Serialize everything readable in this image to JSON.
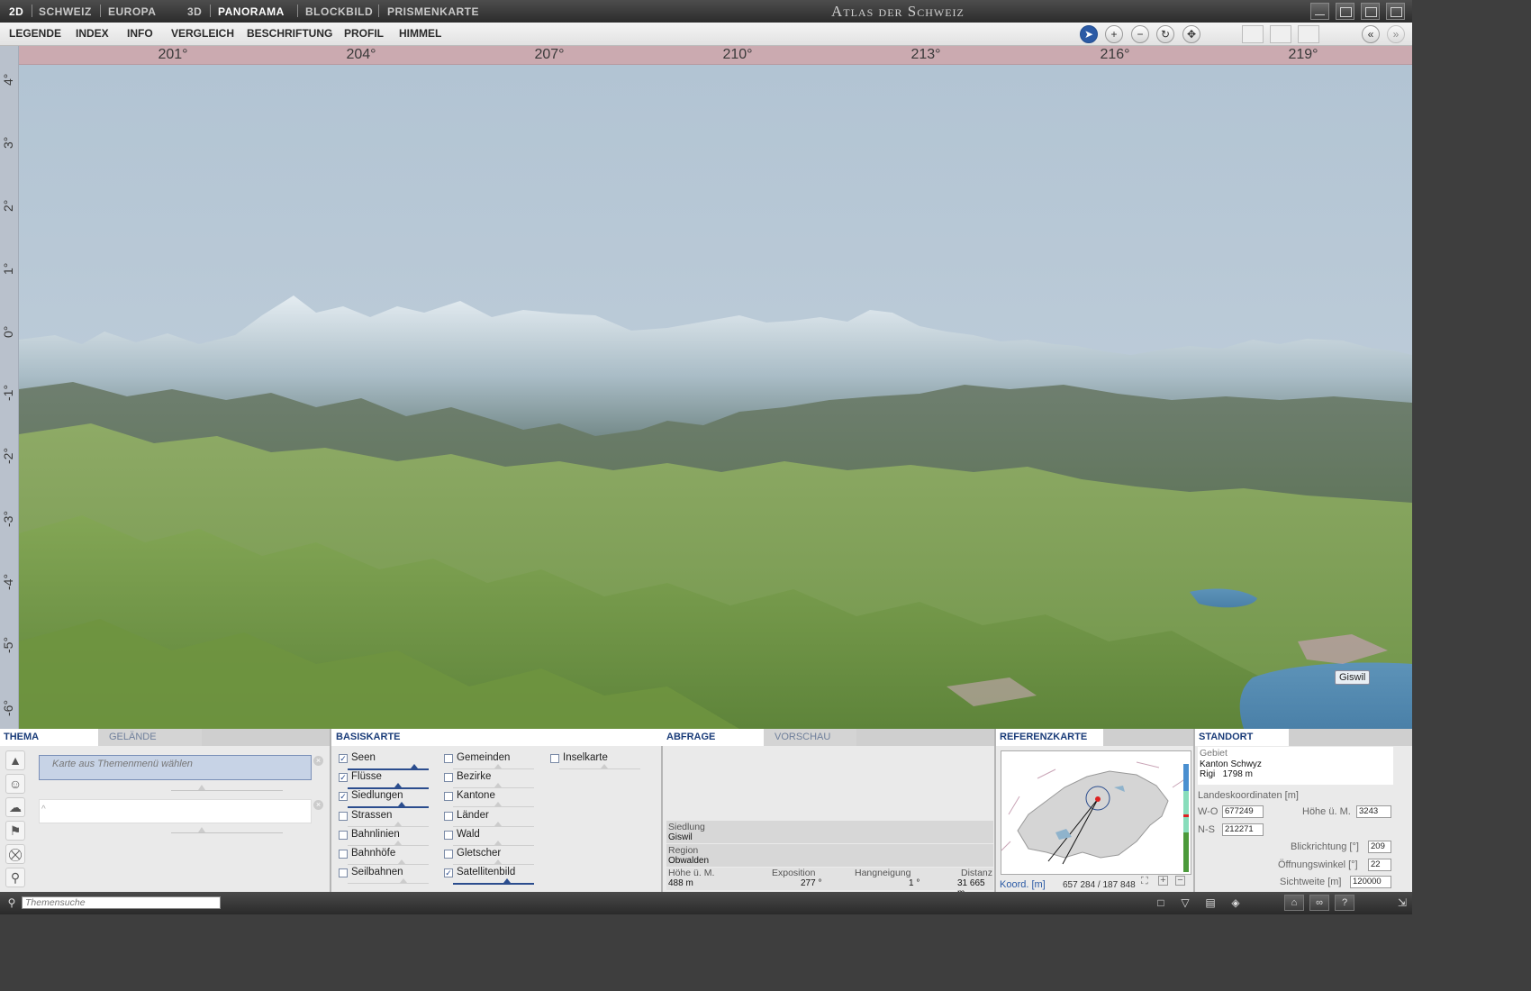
{
  "window": {
    "modes": [
      "2D",
      "SCHWEIZ",
      "EUROPA",
      "3D",
      "PANORAMA",
      "BLOCKBILD",
      "PRISMENKARTE"
    ],
    "active_modes": [
      "2D",
      "PANORAMA"
    ],
    "app_title": "Atlas der Schweiz"
  },
  "menu": [
    "LEGENDE",
    "INDEX",
    "INFO",
    "VERGLEICH",
    "BESCHRIFTUNG",
    "PROFIL",
    "HIMMEL"
  ],
  "toolbar_icons": [
    "pointer-icon",
    "zoom-in-icon",
    "zoom-out-icon",
    "rotate-icon",
    "pan-icon"
  ],
  "view_icons": [
    "horizontal-split-icon",
    "vertical-split-icon",
    "no-split-icon"
  ],
  "compass": {
    "labels": [
      "201°",
      "204°",
      "207°",
      "210°",
      "213°",
      "216°",
      "219°"
    ],
    "values": [
      201,
      204,
      207,
      210,
      213,
      216,
      219
    ]
  },
  "inclination": [
    "4°",
    "3°",
    "2°",
    "1°",
    "0°",
    "-1°",
    "-2°",
    "-3°",
    "-4°",
    "-5°",
    "-6°"
  ],
  "view_label": "Giswil",
  "thema": {
    "tab_active": "THEMA",
    "tab_inactive": "GELÄNDE",
    "select_placeholder": "Karte aus Themenmenü wählen",
    "second_value": "^",
    "icons": [
      "tree-icon",
      "people-icon",
      "cloud-icon",
      "flag-icon",
      "train-icon",
      "satellite-icon"
    ]
  },
  "basiskarte": {
    "title": "BASISKARTE",
    "col1": [
      {
        "label": "Seen",
        "checked": true
      },
      {
        "label": "Flüsse",
        "checked": true
      },
      {
        "label": "Siedlungen",
        "checked": true
      },
      {
        "label": "Strassen",
        "checked": false
      },
      {
        "label": "Bahnlinien",
        "checked": false
      },
      {
        "label": "Bahnhöfe",
        "checked": false
      },
      {
        "label": "Seilbahnen",
        "checked": false
      }
    ],
    "col2": [
      {
        "label": "Gemeinden",
        "checked": false
      },
      {
        "label": "Bezirke",
        "checked": false
      },
      {
        "label": "Kantone",
        "checked": false
      },
      {
        "label": "Länder",
        "checked": false
      },
      {
        "label": "Wald",
        "checked": false
      },
      {
        "label": "Gletscher",
        "checked": false
      },
      {
        "label": "Satellitenbild",
        "checked": true
      }
    ],
    "col3": [
      {
        "label": "Inselkarte",
        "checked": false
      }
    ]
  },
  "abfrage": {
    "tab_active": "ABFRAGE",
    "tab_inactive": "VORSCHAU",
    "siedlung_label": "Siedlung",
    "siedlung_value": "Giswil",
    "region_label": "Region",
    "region_value": "Obwalden",
    "hoehe_label": "Höhe ü. M.",
    "hoehe_value": "488 m",
    "exposition_label": "Exposition",
    "exposition_value": "277 °",
    "hang_label": "Hangneigung",
    "hang_value": "1 °",
    "distanz_label": "Distanz",
    "distanz_value": "31 665 m"
  },
  "referenz": {
    "title": "REFERENZKARTE",
    "koord_label": "Koord. [m]",
    "koord_value": "657 284 / 187 848"
  },
  "standort": {
    "title": "STANDORT",
    "gebiet_label": "Gebiet",
    "gebiet_value": "Kanton Schwyz",
    "place": "Rigi",
    "place_height": "1798 m",
    "lk_label": "Landeskoordinaten [m]",
    "wo_label": "W-O",
    "wo_value": "677249",
    "ns_label": "N-S",
    "ns_value": "212271",
    "hoehe_label": "Höhe ü. M.",
    "hoehe_value": "3243",
    "blick_label": "Blickrichtung [°]",
    "blick_value": "209",
    "oeff_label": "Öffnungswinkel [°]",
    "oeff_value": "22",
    "sicht_label": "Sichtweite [m]",
    "sicht_value": "120000"
  },
  "statusbar": {
    "search_placeholder": "Themensuche",
    "help": "?"
  }
}
